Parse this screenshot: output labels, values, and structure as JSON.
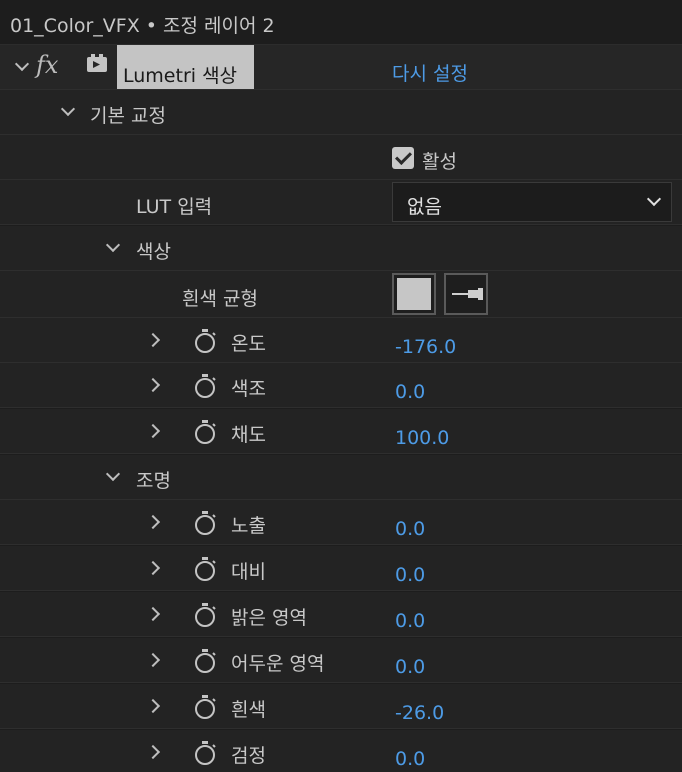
{
  "header": {
    "title": "01_Color_VFX • 조정 레이어 2"
  },
  "effect": {
    "fx_icon": "fx",
    "name": "Lumetri 색상",
    "reset_label": "다시 설정"
  },
  "basic": {
    "section_label": "기본 교정",
    "active_label": "활성",
    "active_checked": true,
    "lut_label": "LUT 입력",
    "lut_value": "없음"
  },
  "color": {
    "section_label": "색상",
    "white_balance_label": "흰색 균형",
    "swatch_color": "#c6c6c6",
    "params": [
      {
        "label": "온도",
        "value": "-176.0"
      },
      {
        "label": "색조",
        "value": "0.0"
      },
      {
        "label": "채도",
        "value": "100.0"
      }
    ]
  },
  "light": {
    "section_label": "조명",
    "params": [
      {
        "label": "노출",
        "value": "0.0"
      },
      {
        "label": "대비",
        "value": "0.0"
      },
      {
        "label": "밝은 영역",
        "value": "0.0"
      },
      {
        "label": "어두운 영역",
        "value": "0.0"
      },
      {
        "label": "흰색",
        "value": "-26.0"
      },
      {
        "label": "검정",
        "value": "0.0"
      }
    ]
  },
  "colors": {
    "accent": "#4d9be6",
    "background": "#1d1d1d",
    "row": "#232323"
  }
}
